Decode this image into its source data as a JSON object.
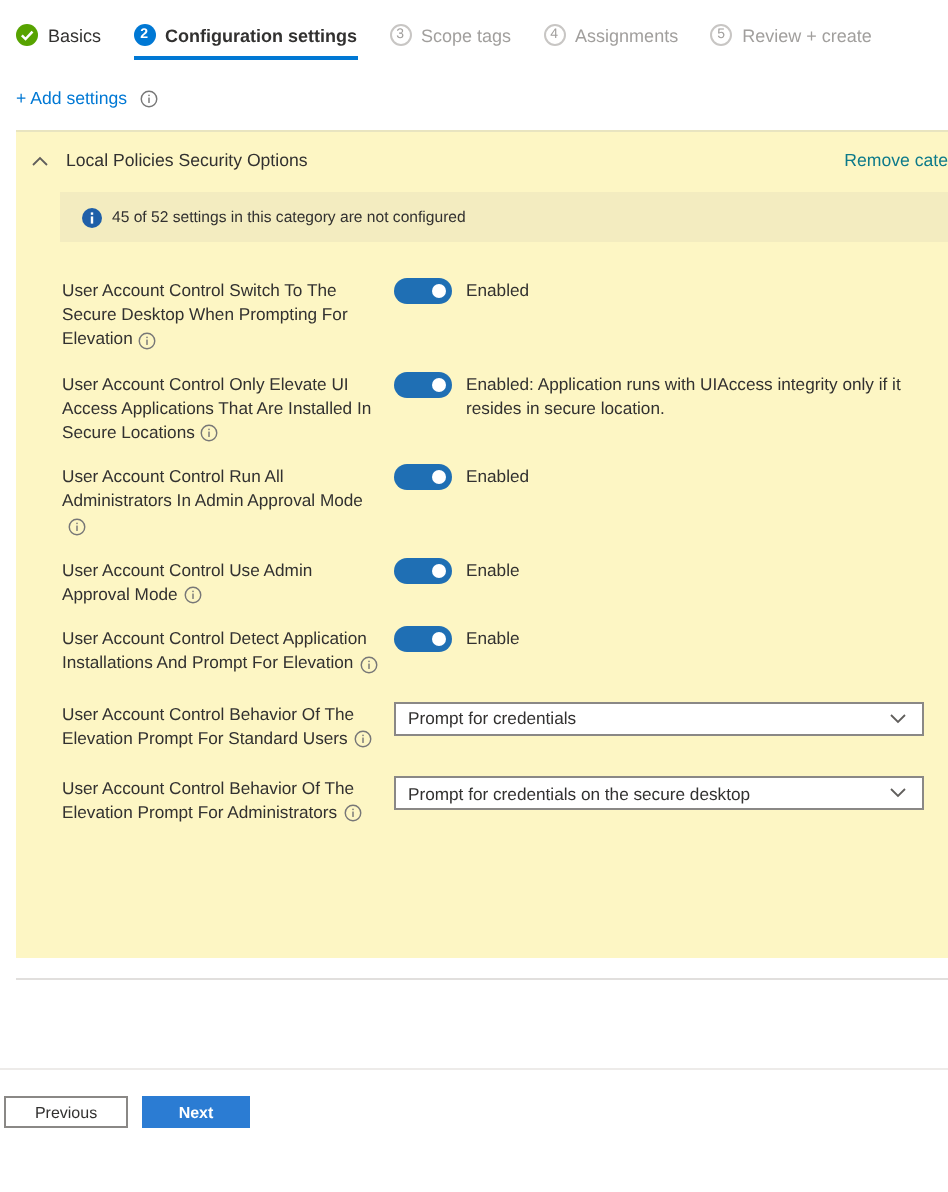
{
  "steps": [
    {
      "label": "Basics",
      "done": true,
      "selected": false
    },
    {
      "number": "2",
      "label": "Configuration settings",
      "done": false,
      "selected": true
    },
    {
      "number": "3",
      "label": "Scope tags",
      "done": false,
      "selected": false
    },
    {
      "number": "4",
      "label": "Assignments",
      "done": false,
      "selected": false
    },
    {
      "number": "5",
      "label": "Review + create",
      "done": false,
      "selected": false
    }
  ],
  "add_settings": "+ Add settings",
  "category": {
    "title": "Local Policies Security Options",
    "expanded": true,
    "remove": "Remove cate",
    "info": "45 of 52 settings in this category are not configured"
  },
  "settings": [
    {
      "kind": "toggle",
      "label": "User Account Control Switch To The Secure Desktop When Prompting For Elevation",
      "on": true,
      "value": "Enabled"
    },
    {
      "kind": "toggle",
      "label": "User Account Control Only Elevate UI Access Applications That Are Installed In Secure Locations",
      "on": true,
      "value": "Enabled: Application runs with UIAccess integrity only if it resides in secure location."
    },
    {
      "kind": "toggle",
      "label": "User Account Control Run All Administrators In Admin Approval Mode",
      "on": true,
      "value": "Enabled"
    },
    {
      "kind": "toggle",
      "label": "User Account Control Use Admin Approval Mode",
      "on": true,
      "value": "Enable"
    },
    {
      "kind": "toggle",
      "label": "User Account Control Detect Application Installations And Prompt For Elevation",
      "on": true,
      "value": "Enable"
    },
    {
      "kind": "dropdown",
      "label": "User Account Control Behavior Of The Elevation Prompt For Standard Users",
      "value": "Prompt for credentials"
    },
    {
      "kind": "dropdown",
      "label": "User Account Control Behavior Of The Elevation Prompt For Administrators",
      "value": "Prompt for credentials on the secure desktop"
    }
  ],
  "buttons": {
    "previous": "Previous",
    "next": "Next"
  }
}
